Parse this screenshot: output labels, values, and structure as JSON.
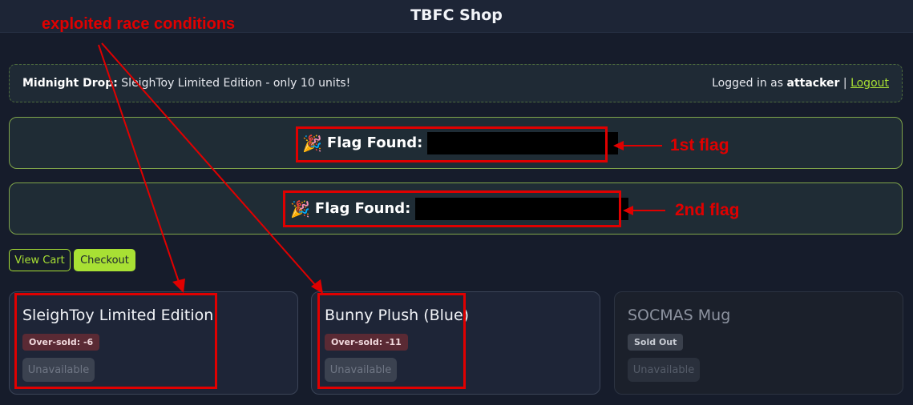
{
  "header": {
    "title": "TBFC Shop"
  },
  "banner": {
    "drop_label": "Midnight Drop:",
    "drop_text": " SleighToy Limited Edition - only 10 units!",
    "logged_in_prefix": "Logged in as ",
    "username": "attacker",
    "separator": " | ",
    "logout_label": "Logout"
  },
  "flags": [
    {
      "emoji": "🎉",
      "label": "Flag Found:"
    },
    {
      "emoji": "🎉",
      "label": "Flag Found:"
    }
  ],
  "actions": {
    "view_cart": "View Cart",
    "checkout": "Checkout"
  },
  "products": [
    {
      "name": "SleighToy Limited Edition",
      "badge": "Over-sold: -6",
      "button": "Unavailable"
    },
    {
      "name": "Bunny Plush (Blue)",
      "badge": "Over-sold: -11",
      "button": "Unavailable"
    },
    {
      "name": "SOCMAS Mug",
      "badge": "Sold Out",
      "button": "Unavailable"
    }
  ],
  "annotations": {
    "race": "exploited race conditions",
    "flag1": "1st flag",
    "flag2": "2nd flag"
  },
  "colors": {
    "accent": "#a8e034",
    "annotation": "#e00000",
    "background": "#161c2b"
  }
}
